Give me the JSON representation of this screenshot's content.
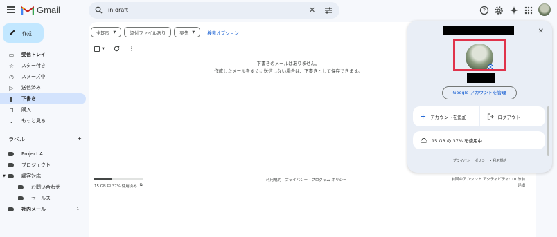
{
  "header": {
    "app_name": "Gmail",
    "search_query": "in:draft"
  },
  "sidebar": {
    "compose_label": "作成",
    "items": [
      {
        "label": "受信トレイ",
        "count": "1",
        "icon": "inbox-icon",
        "glyph": "▭",
        "bold": true
      },
      {
        "label": "スター付き",
        "count": "",
        "icon": "star-icon",
        "glyph": "☆"
      },
      {
        "label": "スヌーズ中",
        "count": "",
        "icon": "clock-icon",
        "glyph": "◷"
      },
      {
        "label": "送信済み",
        "count": "",
        "icon": "send-icon",
        "glyph": "▷"
      },
      {
        "label": "下書き",
        "count": "",
        "icon": "draft-icon",
        "glyph": "▮",
        "active": true
      },
      {
        "label": "購入",
        "count": "",
        "icon": "purchase-icon",
        "glyph": "⊓"
      },
      {
        "label": "もっと見る",
        "count": "",
        "icon": "chevron-down-icon",
        "glyph": "⌄"
      }
    ],
    "labels_title": "ラベル",
    "labels": [
      {
        "label": "Project A",
        "count": ""
      },
      {
        "label": "プロジェクト",
        "count": ""
      },
      {
        "label": "顧客対応",
        "count": "",
        "expanded": true
      },
      {
        "label": "お問い合わせ",
        "count": "",
        "sub": true
      },
      {
        "label": "セールス",
        "count": "",
        "sub": true
      },
      {
        "label": "社内メール",
        "count": "1",
        "bold": true
      }
    ]
  },
  "main": {
    "filter_chips": [
      "全期間",
      "添付ファイルあり",
      "宛先"
    ],
    "advanced_search": "検索オプション",
    "empty_line1": "下書きのメールはありません。",
    "empty_line2": "作成したメールをすぐに送信しない場合は、下書きとして保存できます。",
    "storage_text": "15 GB 中 37% 使用済み",
    "storage_fraction": 0.37,
    "footer_links": "利用規約 · プライバシー · プログラム ポリシー",
    "activity_line1": "前回のアカウント アクティビティ: 10 分前",
    "activity_line2": "詳細"
  },
  "account_panel": {
    "manage_button": "Google アカウントを管理",
    "add_account": "アカウントを追加",
    "logout": "ログアウト",
    "storage_usage": "15 GB の 37% を使用中",
    "footer": "プライバシー ポリシー  •  利用規約"
  },
  "colors": {
    "compose_bg": "#c2e7ff",
    "active_nav_bg": "#d3e3fd",
    "link_blue": "#0b57d0",
    "highlight_red": "#e0334b"
  }
}
